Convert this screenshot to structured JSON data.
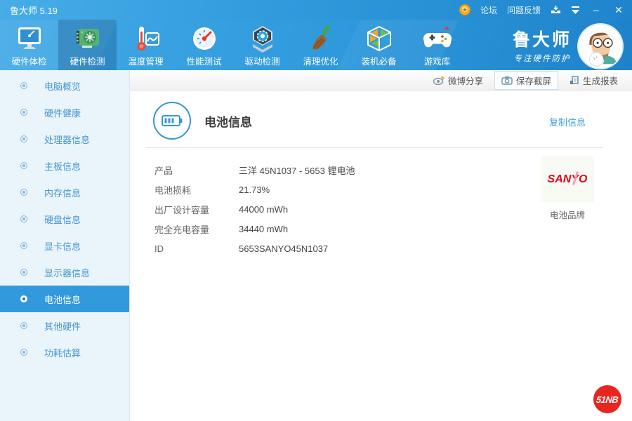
{
  "titlebar": {
    "title": "鲁大师 5.19",
    "forum": "论坛",
    "feedback": "问题反馈",
    "minimize_glyph": "–",
    "close_glyph": "✕"
  },
  "toolbar": {
    "items": [
      {
        "label": "硬件体检",
        "icon": "monitor-radar",
        "active": false
      },
      {
        "label": "硬件检测",
        "icon": "gpu-card",
        "active": true
      },
      {
        "label": "温度管理",
        "icon": "thermometer-chart",
        "active": false
      },
      {
        "label": "性能测试",
        "icon": "speed-gauge",
        "active": false
      },
      {
        "label": "驱动检测",
        "icon": "gear-hexagon",
        "active": false
      },
      {
        "label": "清理优化",
        "icon": "broom",
        "active": false
      },
      {
        "label": "装机必备",
        "icon": "cube",
        "active": false
      },
      {
        "label": "游戏库",
        "icon": "gamepad",
        "active": false
      }
    ],
    "brand": {
      "name": "鲁大师",
      "slogan": "专注硬件防护"
    }
  },
  "actionbar": {
    "items": [
      {
        "label": "微博分享",
        "icon": "weibo"
      },
      {
        "label": "保存截屏",
        "icon": "camera",
        "boxed": true
      },
      {
        "label": "生成报表",
        "icon": "report"
      }
    ]
  },
  "sidebar": {
    "items": [
      {
        "label": "电脑概览",
        "active": false
      },
      {
        "label": "硬件健康",
        "active": false
      },
      {
        "label": "处理器信息",
        "active": false
      },
      {
        "label": "主板信息",
        "active": false
      },
      {
        "label": "内存信息",
        "active": false
      },
      {
        "label": "硬盘信息",
        "active": false
      },
      {
        "label": "显卡信息",
        "active": false
      },
      {
        "label": "显示器信息",
        "active": false
      },
      {
        "label": "电池信息",
        "active": true
      },
      {
        "label": "其他硬件",
        "active": false
      },
      {
        "label": "功耗估算",
        "active": false
      }
    ]
  },
  "content": {
    "title": "电池信息",
    "copy_link": "复制信息",
    "rows": [
      {
        "label": "产品",
        "value": "三洋 45N1037 -  5653 锂电池"
      },
      {
        "label": "电池损耗",
        "value": "21.73%"
      },
      {
        "label": "出厂设计容量",
        "value": "44000 mWh"
      },
      {
        "label": "完全充电容量",
        "value": "34440 mWh"
      },
      {
        "label": "ID",
        "value": "5653SANYO45N1037"
      }
    ],
    "brand_logo": "SANYO",
    "brand_caption": "电池品牌"
  },
  "watermark": {
    "text": "51NB"
  },
  "colors": {
    "header_blue_light": "#47ade8",
    "header_blue_dark": "#1f84cc",
    "toolbar_active_overlay": "#09406e",
    "sidebar_bg": "#e9f4fb",
    "sidebar_text": "#4796cf",
    "sidebar_active_bg": "#3399dd",
    "accent_blue": "#3598d2",
    "link_blue": "#3da0d8",
    "sanyo_red": "#e60012",
    "watermark_red": "#e8251f"
  }
}
